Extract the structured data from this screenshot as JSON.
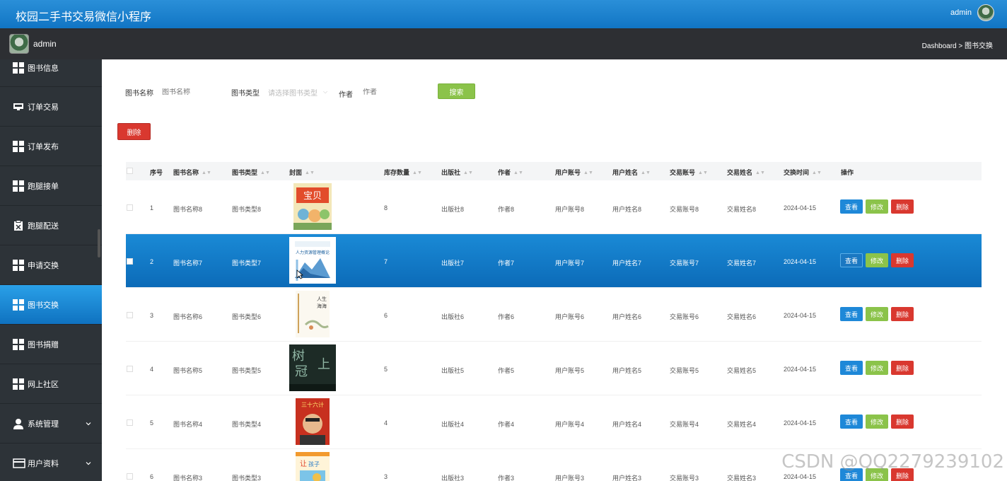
{
  "app": {
    "title": "校园二手书交易微信小程序",
    "user": "admin"
  },
  "subbar": {
    "user": "admin",
    "breadcrumb": "Dashboard > 图书交换"
  },
  "sidebar": {
    "items": [
      {
        "label": "图书信息",
        "icon": "grid-icon"
      },
      {
        "label": "订单交易",
        "icon": "inbox-icon"
      },
      {
        "label": "订单发布",
        "icon": "grid-icon"
      },
      {
        "label": "跑腿接单",
        "icon": "grid-icon"
      },
      {
        "label": "跑腿配送",
        "icon": "clipboard-x-icon"
      },
      {
        "label": "申请交换",
        "icon": "grid-icon"
      },
      {
        "label": "图书交换",
        "icon": "grid-icon",
        "active": true
      },
      {
        "label": "图书捐赠",
        "icon": "grid-icon"
      },
      {
        "label": "网上社区",
        "icon": "grid-icon"
      },
      {
        "label": "系统管理",
        "icon": "user-icon",
        "expandable": true
      },
      {
        "label": "用户资料",
        "icon": "card-icon",
        "expandable": true
      }
    ]
  },
  "search": {
    "name_label": "图书名称",
    "name_placeholder": "图书名称",
    "type_label": "图书类型",
    "type_placeholder": "请选择图书类型",
    "author_label": "作者",
    "author_placeholder": "作者",
    "button": "搜索"
  },
  "toolbar": {
    "delete": "删除"
  },
  "table": {
    "headers": [
      "序号",
      "图书名称",
      "图书类型",
      "封面",
      "库存数量",
      "出版社",
      "作者",
      "用户账号",
      "用户姓名",
      "交易账号",
      "交易姓名",
      "交换时间",
      "操作"
    ],
    "actions": {
      "view": "查看",
      "edit": "修改",
      "delete": "删除"
    },
    "rows": [
      {
        "no": "1",
        "name": "图书名称8",
        "type": "图书类型8",
        "stock": "8",
        "publisher": "出版社8",
        "author": "作者8",
        "user_account": "用户账号8",
        "user_name": "用户姓名8",
        "trade_account": "交易账号8",
        "trade_name": "交易姓名8",
        "time": "2024-04-15",
        "cover": "cover-comic"
      },
      {
        "no": "2",
        "name": "图书名称7",
        "type": "图书类型7",
        "stock": "7",
        "publisher": "出版社7",
        "author": "作者7",
        "user_account": "用户账号7",
        "user_name": "用户姓名7",
        "trade_account": "交易账号7",
        "trade_name": "交易姓名7",
        "time": "2024-04-15",
        "cover": "cover-blue",
        "selected": true
      },
      {
        "no": "3",
        "name": "图书名称6",
        "type": "图书类型6",
        "stock": "6",
        "publisher": "出版社6",
        "author": "作者6",
        "user_account": "用户账号6",
        "user_name": "用户姓名6",
        "trade_account": "交易账号6",
        "trade_name": "交易姓名6",
        "time": "2024-04-15",
        "cover": "cover-ink"
      },
      {
        "no": "4",
        "name": "图书名称5",
        "type": "图书类型5",
        "stock": "5",
        "publisher": "出版社5",
        "author": "作者5",
        "user_account": "用户账号5",
        "user_name": "用户姓名5",
        "trade_account": "交易账号5",
        "trade_name": "交易姓名5",
        "time": "2024-04-15",
        "cover": "cover-dark"
      },
      {
        "no": "5",
        "name": "图书名称4",
        "type": "图书类型4",
        "stock": "4",
        "publisher": "出版社4",
        "author": "作者4",
        "user_account": "用户账号4",
        "user_name": "用户姓名4",
        "trade_account": "交易账号4",
        "trade_name": "交易姓名4",
        "time": "2024-04-15",
        "cover": "cover-red"
      },
      {
        "no": "6",
        "name": "图书名称3",
        "type": "图书类型3",
        "stock": "3",
        "publisher": "出版社3",
        "author": "作者3",
        "user_account": "用户账号3",
        "user_name": "用户姓名3",
        "trade_account": "交易账号3",
        "trade_name": "交易姓名3",
        "time": "2024-04-15",
        "cover": "cover-kids"
      }
    ]
  },
  "watermark": "CSDN @QQ2279239102"
}
